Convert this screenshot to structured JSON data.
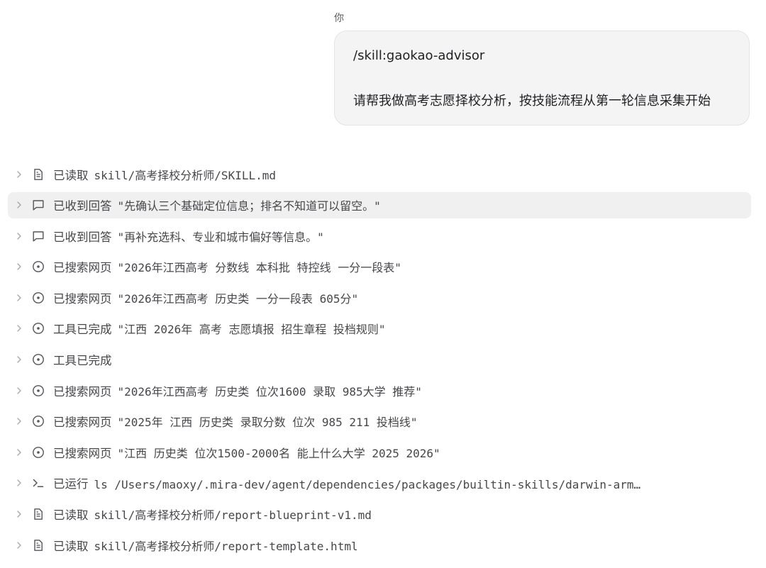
{
  "user": {
    "label": "你",
    "message_line1": "/skill:gaokao-advisor",
    "message_line2": "请帮我做高考志愿择校分析，按技能流程从第一轮信息采集开始"
  },
  "steps": [
    {
      "icon": "file-icon",
      "action": "已读取",
      "detail": "skill/高考择校分析师/SKILL.md"
    },
    {
      "icon": "chat-bubble-icon",
      "action": "已收到回答",
      "detail": "\"先确认三个基础定位信息；排名不知道可以留空。\""
    },
    {
      "icon": "chat-bubble-icon",
      "action": "已收到回答",
      "detail": "\"再补充选科、专业和城市偏好等信息。\""
    },
    {
      "icon": "search-circle-icon",
      "action": "已搜索网页",
      "detail": "\"2026年江西高考 分数线 本科批 特控线 一分一段表\""
    },
    {
      "icon": "search-circle-icon",
      "action": "已搜索网页",
      "detail": "\"2026年江西高考 历史类 一分一段表 605分\""
    },
    {
      "icon": "search-circle-icon",
      "action": "工具已完成",
      "detail": "\"江西 2026年 高考 志愿填报 招生章程 投档规则\""
    },
    {
      "icon": "search-circle-icon",
      "action": "工具已完成",
      "detail": ""
    },
    {
      "icon": "search-circle-icon",
      "action": "已搜索网页",
      "detail": "\"2026年江西高考 历史类 位次1600 录取 985大学 推荐\""
    },
    {
      "icon": "search-circle-icon",
      "action": "已搜索网页",
      "detail": "\"2025年 江西 历史类 录取分数 位次 985 211 投档线\""
    },
    {
      "icon": "search-circle-icon",
      "action": "已搜索网页",
      "detail": "\"江西 历史类 位次1500-2000名 能上什么大学 2025 2026\""
    },
    {
      "icon": "terminal-icon",
      "action": "已运行",
      "detail": "ls /Users/maoxy/.mira-dev/agent/dependencies/packages/builtin-skills/darwin-arm…"
    },
    {
      "icon": "file-icon",
      "action": "已读取",
      "detail": "skill/高考择校分析师/report-blueprint-v1.md"
    },
    {
      "icon": "file-icon",
      "action": "已读取",
      "detail": "skill/高考择校分析师/report-template.html"
    }
  ]
}
